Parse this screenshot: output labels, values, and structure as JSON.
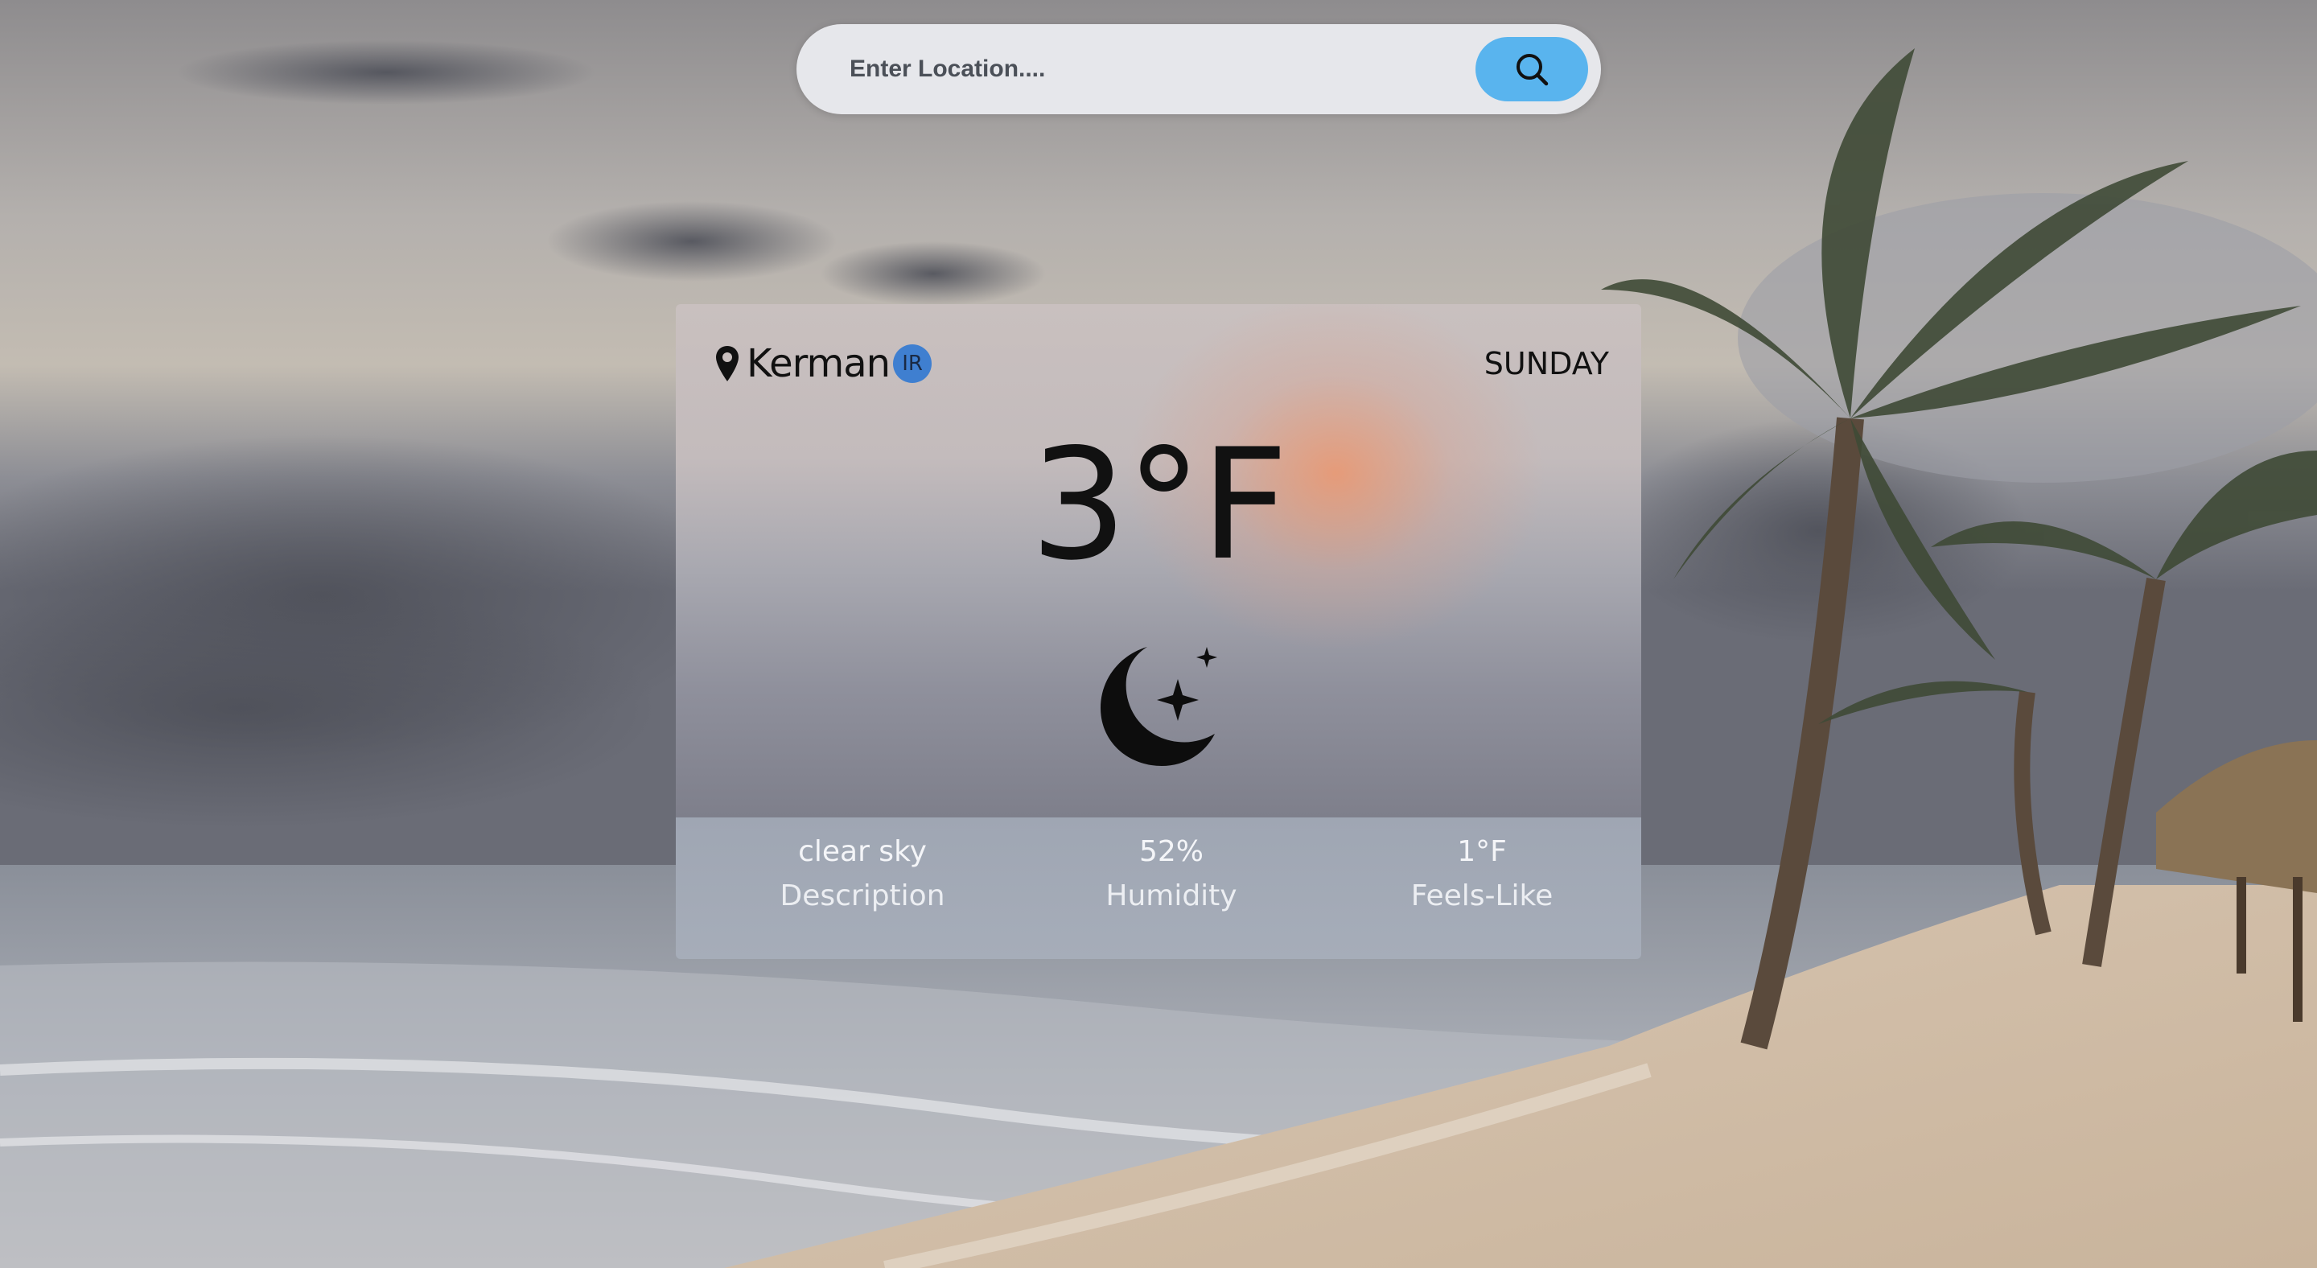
{
  "search": {
    "placeholder": "Enter Location....",
    "icon": "search-icon"
  },
  "weather": {
    "city": "Kerman",
    "country": "IR",
    "day": "SUNDAY",
    "temperature": "3°F",
    "condition_icon": "moon-stars-icon",
    "stats": [
      {
        "value": "clear sky",
        "label": "Description"
      },
      {
        "value": "52%",
        "label": "Humidity"
      },
      {
        "value": "1°F",
        "label": "Feels-Like"
      }
    ]
  },
  "colors": {
    "search_button": "#59b4ee",
    "country_badge": "#3f7fd0"
  }
}
